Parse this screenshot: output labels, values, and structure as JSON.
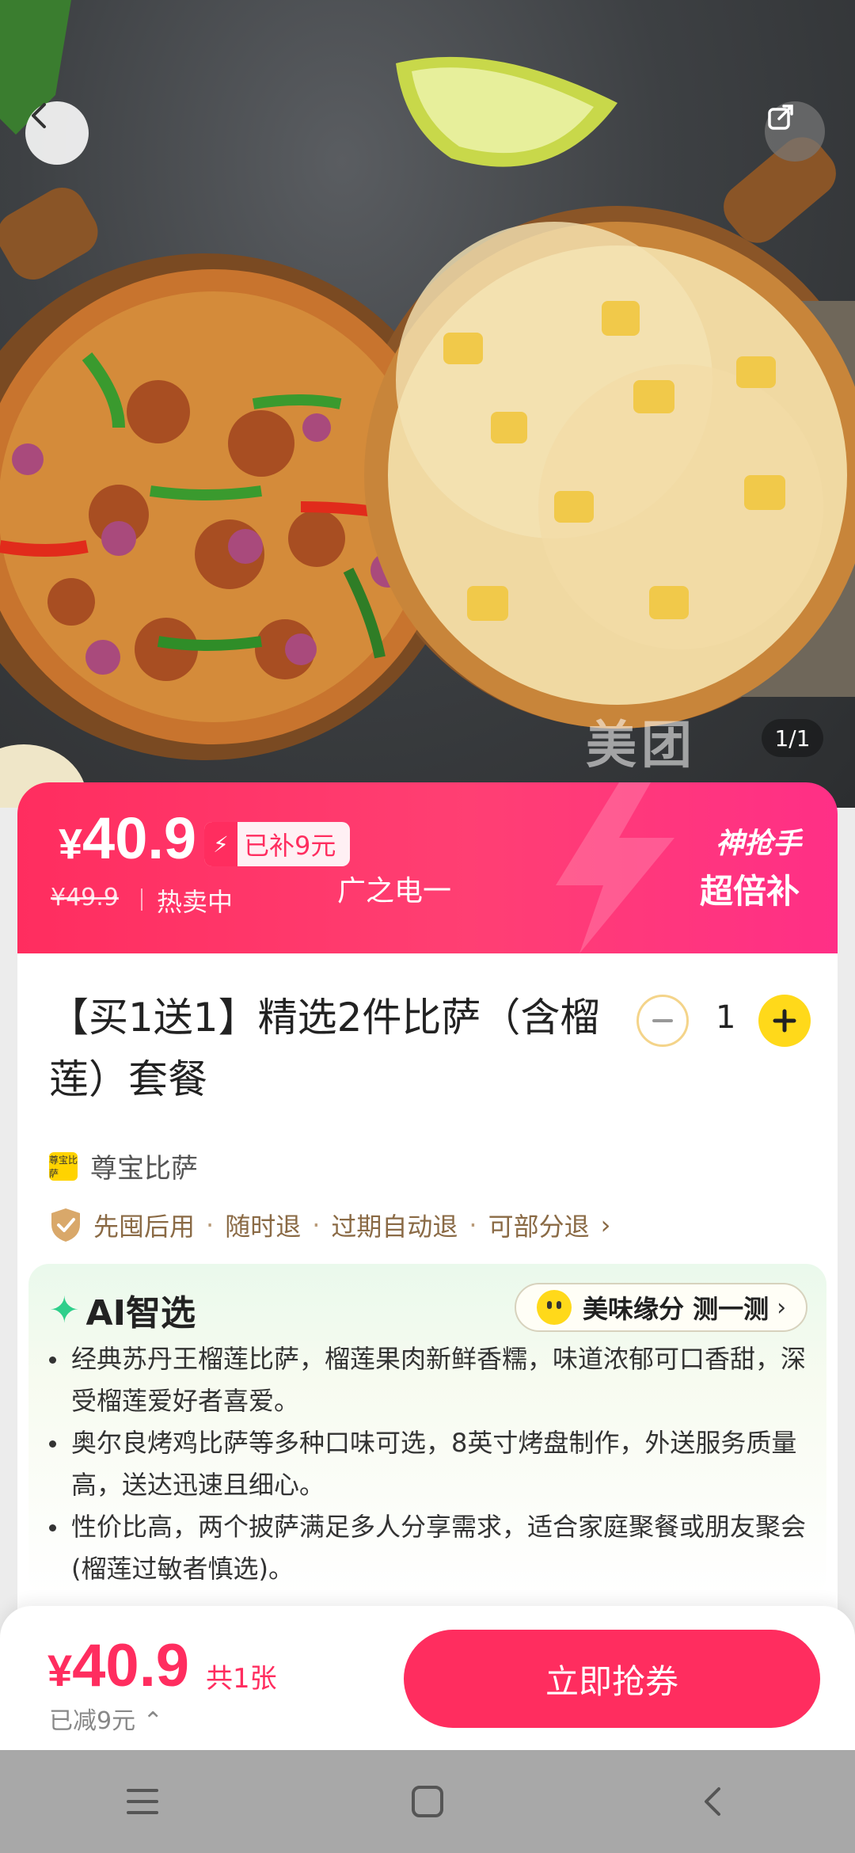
{
  "hero": {
    "watermark": "美团",
    "image_counter": "1/1",
    "back_icon": "chevron-left-icon",
    "share_icon": "share-icon"
  },
  "price_banner": {
    "currency": "¥",
    "price": "40.9",
    "subsidy_badge": "已补9元",
    "original_price": "¥49.9",
    "status": "热卖中",
    "brand_text": "广之电一",
    "promo_line1": "神抢手",
    "promo_line2": "超倍补",
    "gradient_colors": [
      "#ff2d5f",
      "#ff2f86"
    ]
  },
  "product": {
    "title": "【买1送1】精选2件比萨（含榴莲）套餐",
    "quantity": "1",
    "shop_logo_text": "尊宝比萨",
    "shop_name": "尊宝比萨",
    "guarantees": [
      "先囤后用",
      "随时退",
      "过期自动退",
      "可部分退"
    ],
    "guarantee_separator": "·",
    "guarantee_arrow": "›"
  },
  "ai": {
    "title": "AI智选",
    "chip_label": "美味缘分 测一测",
    "chip_arrow": "›",
    "bullets": [
      "经典苏丹王榴莲比萨，榴莲果肉新鲜香糯，味道浓郁可口香甜，深受榴莲爱好者喜爱。",
      "奥尔良烤鸡比萨等多种口味可选，8英寸烤盘制作，外送服务质量高，送达迅速且细心。",
      "性价比高，两个披萨满足多人分享需求，适合家庭聚餐或朋友聚会(榴莲过敏者慎选)。"
    ]
  },
  "bottom_bar": {
    "currency": "¥",
    "price": "40.9",
    "count": "共1张",
    "saved": "已减9元 ⌃",
    "buy_label": "立即抢券",
    "accent": "#ff2d5f"
  },
  "system_nav": {
    "menu_icon": "menu-icon",
    "home_icon": "home-square-icon",
    "back_icon": "back-triangle-icon"
  }
}
